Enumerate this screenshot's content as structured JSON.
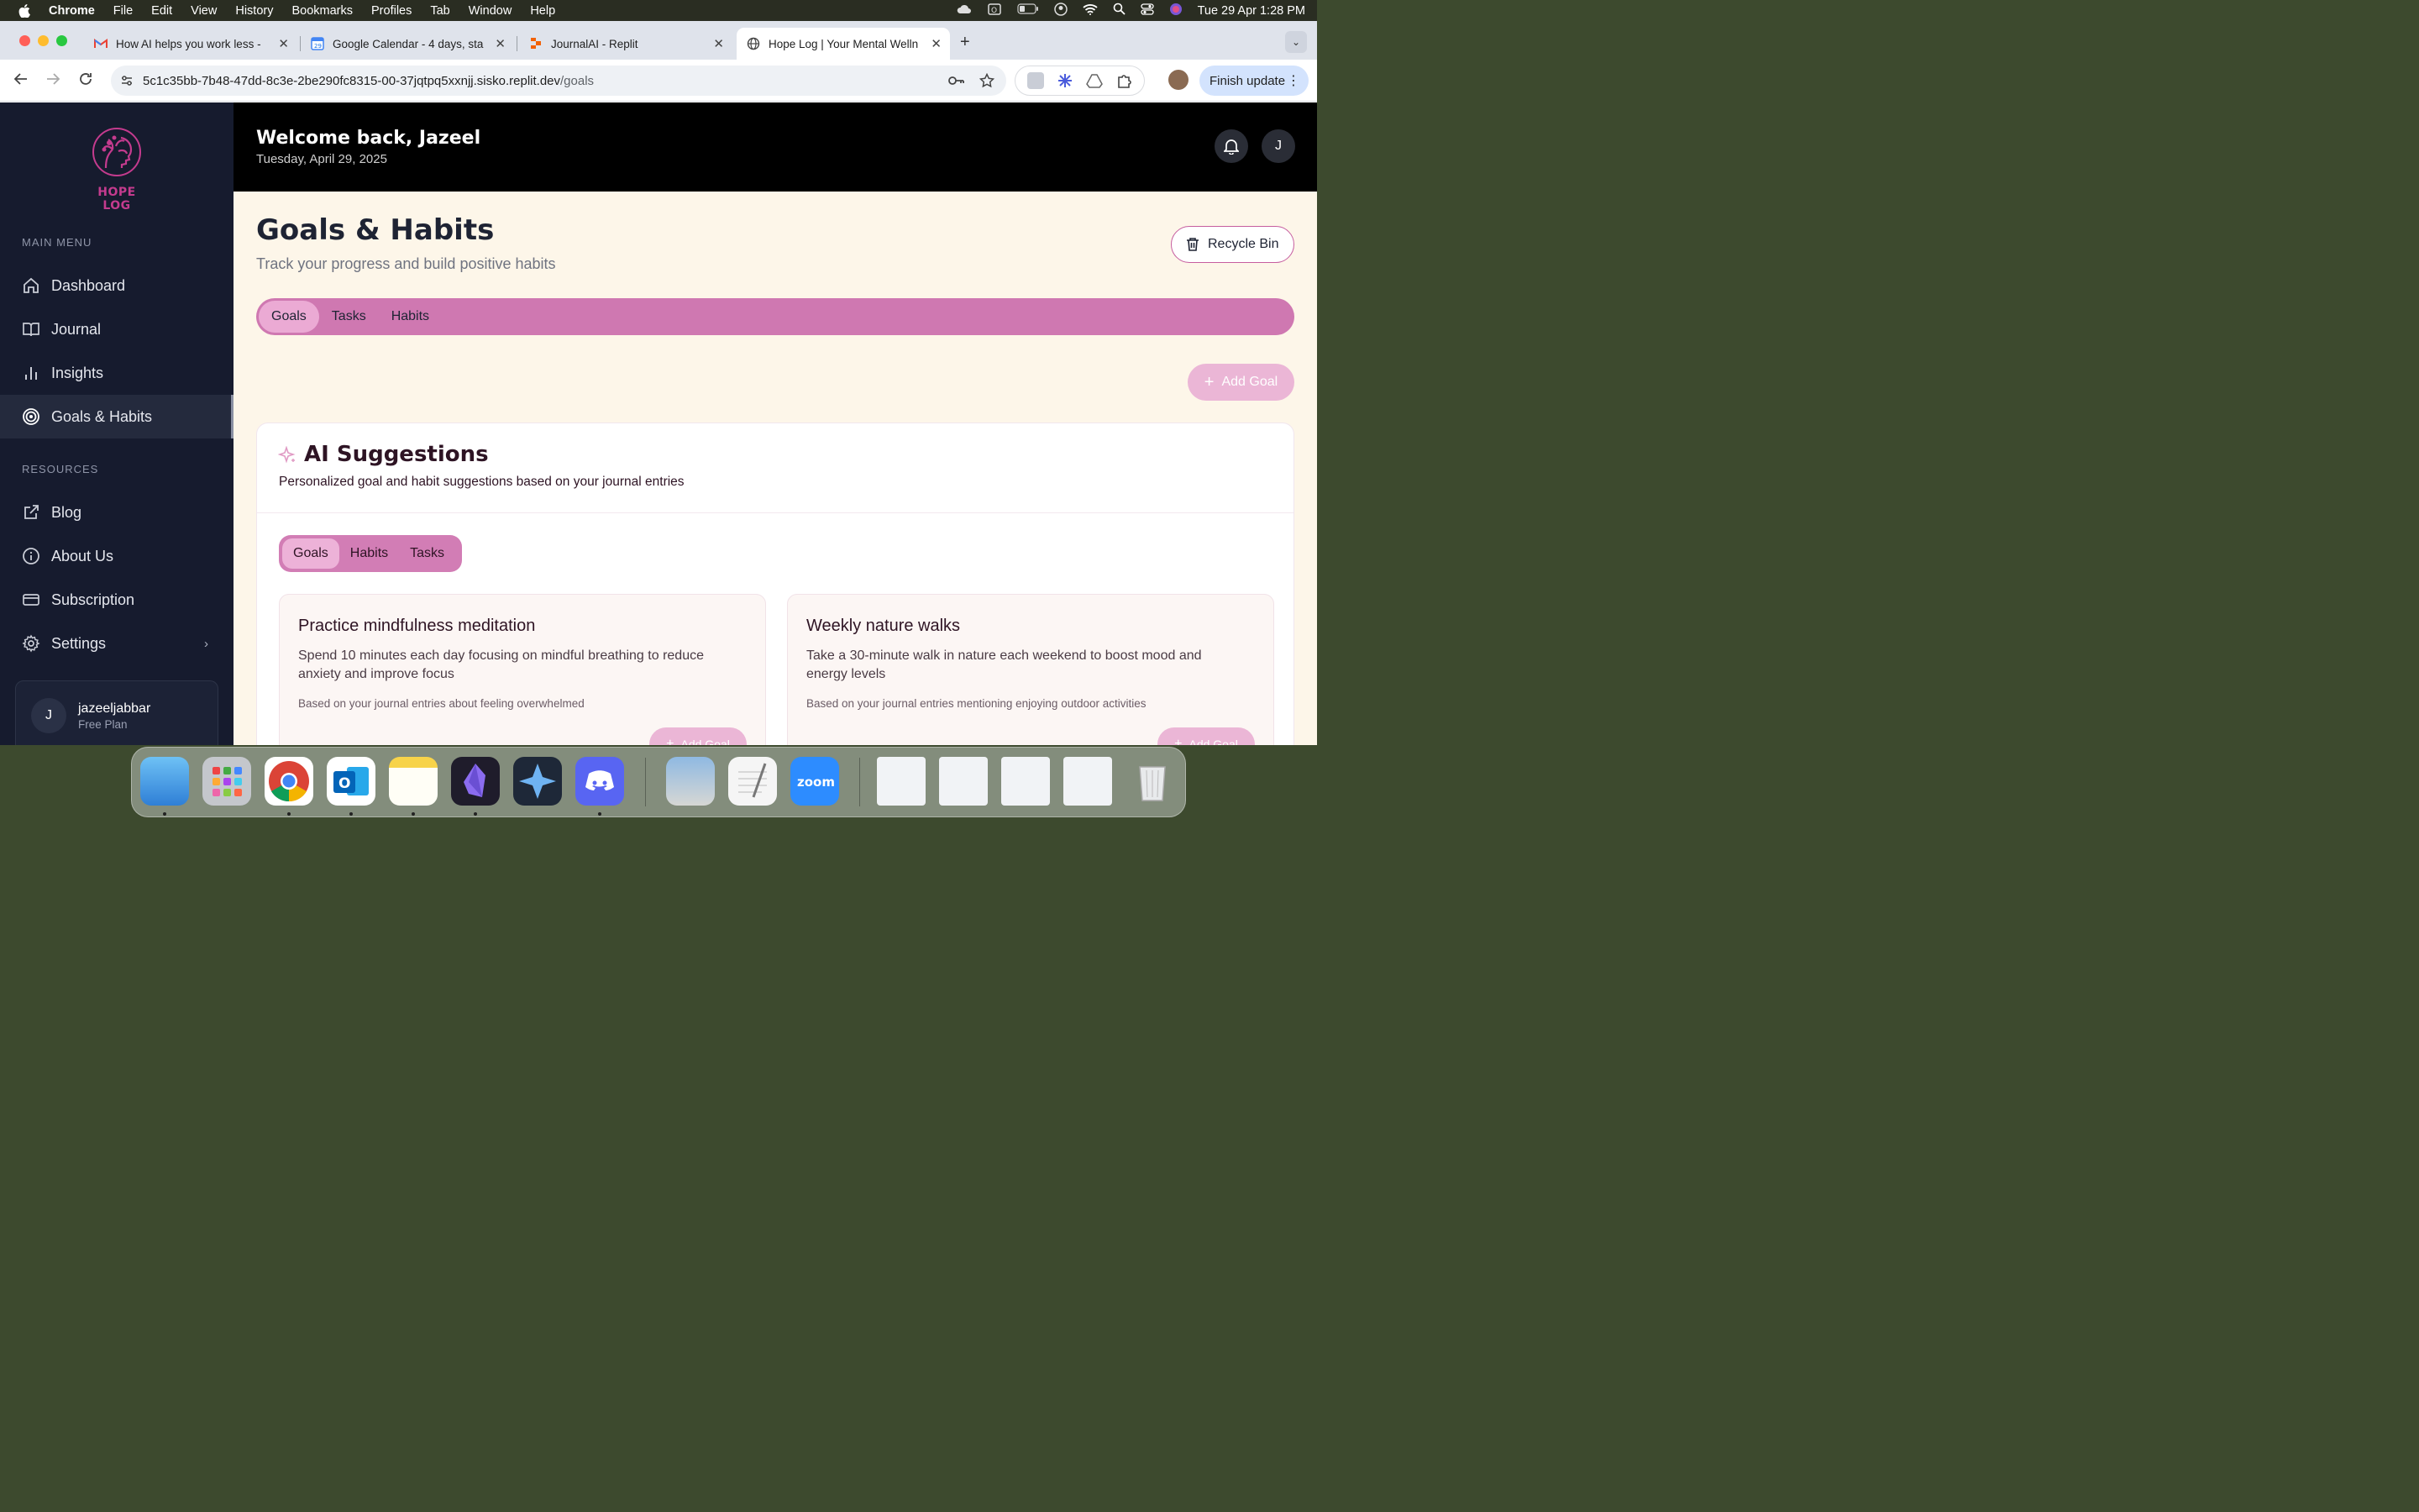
{
  "menubar": {
    "app": "Chrome",
    "items": [
      "File",
      "Edit",
      "View",
      "History",
      "Bookmarks",
      "Profiles",
      "Tab",
      "Window",
      "Help"
    ],
    "datetime": "Tue 29 Apr  1:28 PM"
  },
  "browser": {
    "tabs": [
      {
        "title": "How AI helps you work less -",
        "icon": "gmail-icon"
      },
      {
        "title": "Google Calendar - 4 days, sta",
        "icon": "calendar-icon"
      },
      {
        "title": "JournalAI - Replit",
        "icon": "replit-icon"
      },
      {
        "title": "Hope Log | Your Mental Welln",
        "icon": "globe-icon",
        "active": true
      }
    ],
    "url_host": "5c1c35bb-7b48-47dd-8c3e-2be290fc8315-00-37jqtpq5xxnjj.sisko.replit.dev",
    "url_path": "/goals",
    "finish_update": "Finish update"
  },
  "sidebar": {
    "logo_text": "HOPE LOG",
    "main_menu_label": "MAIN MENU",
    "main_items": [
      {
        "label": "Dashboard",
        "icon": "home-icon"
      },
      {
        "label": "Journal",
        "icon": "book-icon"
      },
      {
        "label": "Insights",
        "icon": "bar-chart-icon"
      },
      {
        "label": "Goals & Habits",
        "icon": "target-icon",
        "active": true
      }
    ],
    "resources_label": "RESOURCES",
    "resource_items": [
      {
        "label": "Blog",
        "icon": "external-link-icon"
      },
      {
        "label": "About Us",
        "icon": "info-icon"
      },
      {
        "label": "Subscription",
        "icon": "credit-card-icon"
      },
      {
        "label": "Settings",
        "icon": "gear-icon"
      }
    ],
    "user": {
      "initial": "J",
      "name": "jazeeljabbar",
      "plan": "Free Plan"
    }
  },
  "header": {
    "welcome": "Welcome back, Jazeel",
    "date": "Tuesday, April 29, 2025",
    "avatar_initial": "J"
  },
  "page": {
    "title": "Goals & Habits",
    "subtitle": "Track your progress and build positive habits",
    "recycle_bin": "Recycle Bin",
    "tabs": [
      "Goals",
      "Tasks",
      "Habits"
    ],
    "add_goal": "Add Goal"
  },
  "ai": {
    "title": "AI Suggestions",
    "subtitle": "Personalized goal and habit suggestions based on your journal entries",
    "tabs": [
      "Goals",
      "Habits",
      "Tasks"
    ],
    "suggestions": [
      {
        "title": "Practice mindfulness meditation",
        "description": "Spend 10 minutes each day focusing on mindful breathing to reduce anxiety and improve focus",
        "basis": "Based on your journal entries about feeling overwhelmed",
        "button": "Add Goal"
      },
      {
        "title": "Weekly nature walks",
        "description": "Take a 30-minute walk in nature each weekend to boost mood and energy levels",
        "basis": "Based on your journal entries mentioning enjoying outdoor activities",
        "button": "Add Goal"
      }
    ]
  },
  "colors": {
    "accent": "#cf78b1",
    "sidebar_bg": "#161b2e",
    "page_bg": "#fdf6e9",
    "brand": "#c43b8e"
  }
}
